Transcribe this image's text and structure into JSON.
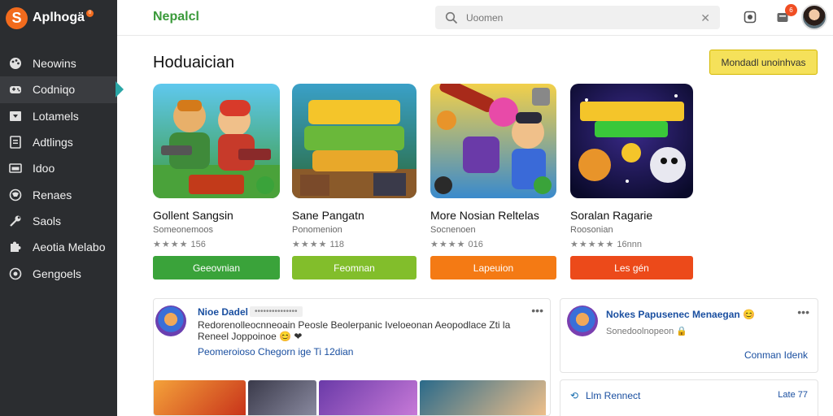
{
  "brand": {
    "logo_letter": "S",
    "name": "Aplhogä",
    "dot": "0"
  },
  "sidebar": {
    "items": [
      {
        "label": "Neowins",
        "icon": "palette-icon"
      },
      {
        "label": "Codniqo",
        "icon": "gamepad-icon",
        "active": true
      },
      {
        "label": "Lotamels",
        "icon": "download-icon"
      },
      {
        "label": "Adtlings",
        "icon": "document-icon"
      },
      {
        "label": "Idoo",
        "icon": "image-icon"
      },
      {
        "label": "Renaes",
        "icon": "globe-icon"
      },
      {
        "label": "Saols",
        "icon": "wrench-icon"
      },
      {
        "label": "Aeotia Melabo",
        "icon": "puzzle-icon"
      },
      {
        "label": "Gengoels",
        "icon": "settings-icon"
      }
    ]
  },
  "header": {
    "title": "Nepalcl",
    "search_placeholder": "Uoomen",
    "notif_count": "6"
  },
  "main": {
    "section_title": "Hoduaician",
    "cta_label": "Mondadl unoinhvas",
    "games": [
      {
        "title": "Gollent Sangsin",
        "subtitle": "Someonemoos",
        "stars": "★★★★",
        "meta": "156",
        "button": "Geeovnian",
        "button_color": "#3aa33a"
      },
      {
        "title": "Sane Pangatn",
        "subtitle": "Ponomenion",
        "stars": "★★★★",
        "meta": "118",
        "button": "Feomnan",
        "button_color": "#82be2b"
      },
      {
        "title": "More Nosian Reltelas",
        "subtitle": "Socnenoen",
        "stars": "★★★★",
        "meta": "016",
        "button": "Lapeuion",
        "button_color": "#f47a14"
      },
      {
        "title": "Soralan Ragarie",
        "subtitle": "Roosonian",
        "stars": "★★★★★",
        "meta": "16nnn",
        "button": "Les gén",
        "button_color": "#ec4a1a"
      }
    ]
  },
  "feed": {
    "post": {
      "name": "Nioe Dadel",
      "tag": "•••••••••••••••",
      "text": "Redorenolleocnneoain Peosle Beolerpanic Iveloeonan Aeopodlace Zti la Reneel Joppoinoe 😊 ❤",
      "link": "Peomeroioso Chegorn ige Ti 12dian",
      "more": "•••"
    }
  },
  "side": {
    "card1": {
      "name": "Nokes Papusenec Menaegan 😊",
      "sub": "Sonedoolnopeon 🔒",
      "link": "Conman Idenk",
      "more": "•••"
    },
    "card2": {
      "icon": "⟲",
      "label": "Llm Rennect",
      "right": "Late 77"
    }
  }
}
